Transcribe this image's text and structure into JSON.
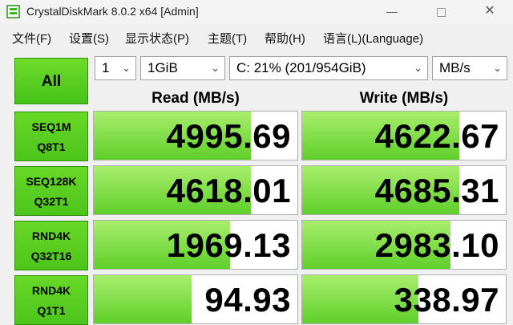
{
  "window": {
    "title": "CrystalDiskMark 8.0.2 x64 [Admin]",
    "minimize_glyph": "—",
    "close_glyph": "✕"
  },
  "menu": [
    {
      "label": "文件(F)"
    },
    {
      "label": "设置(S)"
    },
    {
      "label": "显示状态(P)"
    },
    {
      "label": "主题(T)"
    },
    {
      "label": "帮助(H)"
    },
    {
      "label": "语言(L)(Language)"
    }
  ],
  "controls": {
    "all_button": "All",
    "count": "1",
    "size": "1GiB",
    "drive": "C: 21% (201/954GiB)",
    "unit": "MB/s"
  },
  "headers": {
    "read": "Read (MB/s)",
    "write": "Write (MB/s)"
  },
  "rows": [
    {
      "line1": "SEQ1M",
      "line2": "Q8T1",
      "read": "4995.69",
      "write": "4622.67",
      "read_fill": 0.77,
      "write_fill": 0.77
    },
    {
      "line1": "SEQ128K",
      "line2": "Q32T1",
      "read": "4618.01",
      "write": "4685.31",
      "read_fill": 0.77,
      "write_fill": 0.77
    },
    {
      "line1": "RND4K",
      "line2": "Q32T16",
      "read": "1969.13",
      "write": "2983.10",
      "read_fill": 0.67,
      "write_fill": 0.73
    },
    {
      "line1": "RND4K",
      "line2": "Q1T1",
      "read": "94.93",
      "write": "338.97",
      "read_fill": 0.48,
      "write_fill": 0.57
    }
  ],
  "colors": {
    "accent_green": "#45c218",
    "bar_light": "#a8ee6c"
  }
}
